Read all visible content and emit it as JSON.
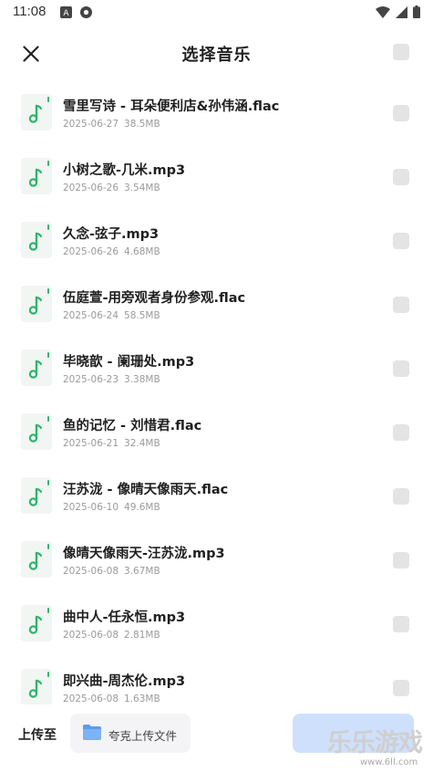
{
  "status_bar": {
    "time": "11:08",
    "left_icons": [
      "a-badge-icon",
      "circle-play-icon"
    ],
    "right_icons": [
      "wifi-icon",
      "cell-signal-icon",
      "battery-icon"
    ]
  },
  "header": {
    "title": "选择音乐",
    "close_icon": "close-icon"
  },
  "files": [
    {
      "name": "雪里写诗 - 耳朵便利店&孙伟涵.flac",
      "date": "2025-06-27",
      "size": "38.5MB"
    },
    {
      "name": "小树之歌-几米.mp3",
      "date": "2025-06-26",
      "size": "3.54MB"
    },
    {
      "name": "久念-弦子.mp3",
      "date": "2025-06-26",
      "size": "4.68MB"
    },
    {
      "name": "伍庭萱-用旁观者身份参观.flac",
      "date": "2025-06-24",
      "size": "58.5MB"
    },
    {
      "name": "毕晓歆 - 阑珊处.mp3",
      "date": "2025-06-23",
      "size": "3.38MB"
    },
    {
      "name": "鱼的记忆 - 刘惜君.flac",
      "date": "2025-06-21",
      "size": "32.4MB"
    },
    {
      "name": "汪苏泷 - 像晴天像雨天.flac",
      "date": "2025-06-10",
      "size": "49.6MB"
    },
    {
      "name": "像晴天像雨天-汪苏泷.mp3",
      "date": "2025-06-08",
      "size": "3.67MB"
    },
    {
      "name": "曲中人-任永恒.mp3",
      "date": "2025-06-08",
      "size": "2.81MB"
    },
    {
      "name": "即兴曲-周杰伦.mp3",
      "date": "2025-06-08",
      "size": "1.63MB"
    }
  ],
  "footer": {
    "upload_to_label": "上传至",
    "destination": "夸克上传文件",
    "confirm_label": ""
  },
  "watermark": {
    "text": "乐乐游戏",
    "url": "www.6ll.com"
  },
  "colors": {
    "music_icon": "#2fb56a",
    "folder_icon": "#5b9cf0",
    "confirm_button": "#cfe0fd",
    "checkbox": "#e4e4e4"
  }
}
